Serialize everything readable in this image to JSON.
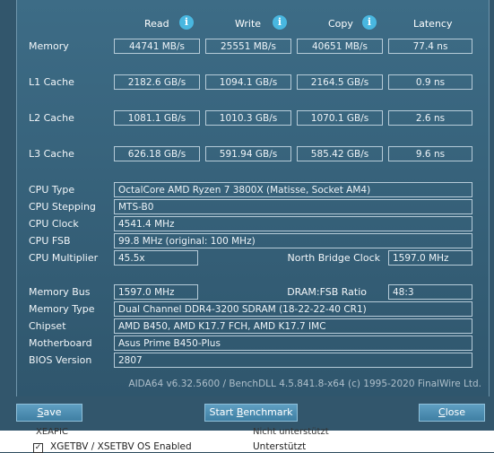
{
  "headers": {
    "read": "Read",
    "write": "Write",
    "copy": "Copy",
    "latency": "Latency",
    "info_glyph": "i"
  },
  "rows": {
    "memory": {
      "label": "Memory",
      "read": "44741 MB/s",
      "write": "25551 MB/s",
      "copy": "40651 MB/s",
      "latency": "77.4 ns"
    },
    "l1": {
      "label": "L1 Cache",
      "read": "2182.6 GB/s",
      "write": "1094.1 GB/s",
      "copy": "2164.5 GB/s",
      "latency": "0.9 ns"
    },
    "l2": {
      "label": "L2 Cache",
      "read": "1081.1 GB/s",
      "write": "1010.3 GB/s",
      "copy": "1070.1 GB/s",
      "latency": "2.6 ns"
    },
    "l3": {
      "label": "L3 Cache",
      "read": "626.18 GB/s",
      "write": "591.94 GB/s",
      "copy": "585.42 GB/s",
      "latency": "9.6 ns"
    }
  },
  "cpu": {
    "type_label": "CPU Type",
    "type_value": "OctalCore AMD Ryzen 7 3800X  (Matisse, Socket AM4)",
    "stepping_label": "CPU Stepping",
    "stepping_value": "MTS-B0",
    "clock_label": "CPU Clock",
    "clock_value": "4541.4 MHz",
    "fsb_label": "CPU FSB",
    "fsb_value": "99.8 MHz  (original: 100 MHz)",
    "mult_label": "CPU Multiplier",
    "mult_value": "45.5x",
    "nb_label": "North Bridge Clock",
    "nb_value": "1597.0 MHz"
  },
  "memory_info": {
    "bus_label": "Memory Bus",
    "bus_value": "1597.0 MHz",
    "ratio_label": "DRAM:FSB Ratio",
    "ratio_value": "48:3",
    "type_label": "Memory Type",
    "type_value": "Dual Channel DDR4-3200 SDRAM  (18-22-22-40 CR1)",
    "chipset_label": "Chipset",
    "chipset_value": "AMD B450, AMD K17.7 FCH, AMD K17.7 IMC",
    "mobo_label": "Motherboard",
    "mobo_value": "Asus Prime B450-Plus",
    "bios_label": "BIOS Version",
    "bios_value": "2807"
  },
  "footer": "AIDA64 v6.32.5600 / BenchDLL 4.5.841.8-x64  (c) 1995-2020 FinalWire Ltd.",
  "buttons": {
    "save_first": "S",
    "save_rest": "ave",
    "bench_pre": "Start ",
    "bench_u": "B",
    "bench_post": "enchmark",
    "close_first": "C",
    "close_rest": "lose"
  },
  "background_window": {
    "row1_left": "XEAPIC",
    "row1_right": "Nicht unterstützt",
    "row2_left": "XGETBV / XSETBV OS Enabled",
    "row2_right": "Unterstützt",
    "check_glyph": "✓"
  },
  "colors": {
    "panel_bg": "#3d6c86",
    "info_icon": "#49b7e0",
    "button_bg": "#4f8fb3"
  }
}
